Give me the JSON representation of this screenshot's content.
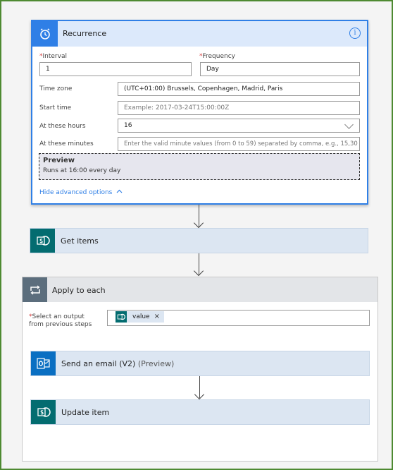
{
  "recurrence": {
    "title": "Recurrence",
    "info_glyph": "i",
    "interval_label": "Interval",
    "interval_value": "1",
    "frequency_label": "Frequency",
    "frequency_value": "Day",
    "timezone_label": "Time zone",
    "timezone_value": "(UTC+01:00) Brussels, Copenhagen, Madrid, Paris",
    "start_time_label": "Start time",
    "start_time_placeholder": "Example: 2017-03-24T15:00:00Z",
    "hours_label": "At these hours",
    "hours_value": "16",
    "minutes_label": "At these minutes",
    "minutes_placeholder": "Enter the valid minute values (from 0 to 59) separated by comma, e.g., 15,30",
    "preview_title": "Preview",
    "preview_text": "Runs at 16:00 every day",
    "hide_advanced": "Hide advanced options"
  },
  "get_items": {
    "title": "Get items"
  },
  "apply_to_each": {
    "title": "Apply to each",
    "select_label_line1": "Select an output",
    "select_label_line2": "from previous steps",
    "token_label": "value",
    "token_remove": "×"
  },
  "send_email": {
    "title": "Send an email (V2)",
    "suffix": "(Preview)"
  },
  "update_item": {
    "title": "Update item"
  },
  "colors": {
    "accent": "#2f7fe6",
    "sharepoint": "#036c70",
    "outlook": "#0a6fc2",
    "loop": "#5c6e7d",
    "frame": "#4e8a32"
  }
}
